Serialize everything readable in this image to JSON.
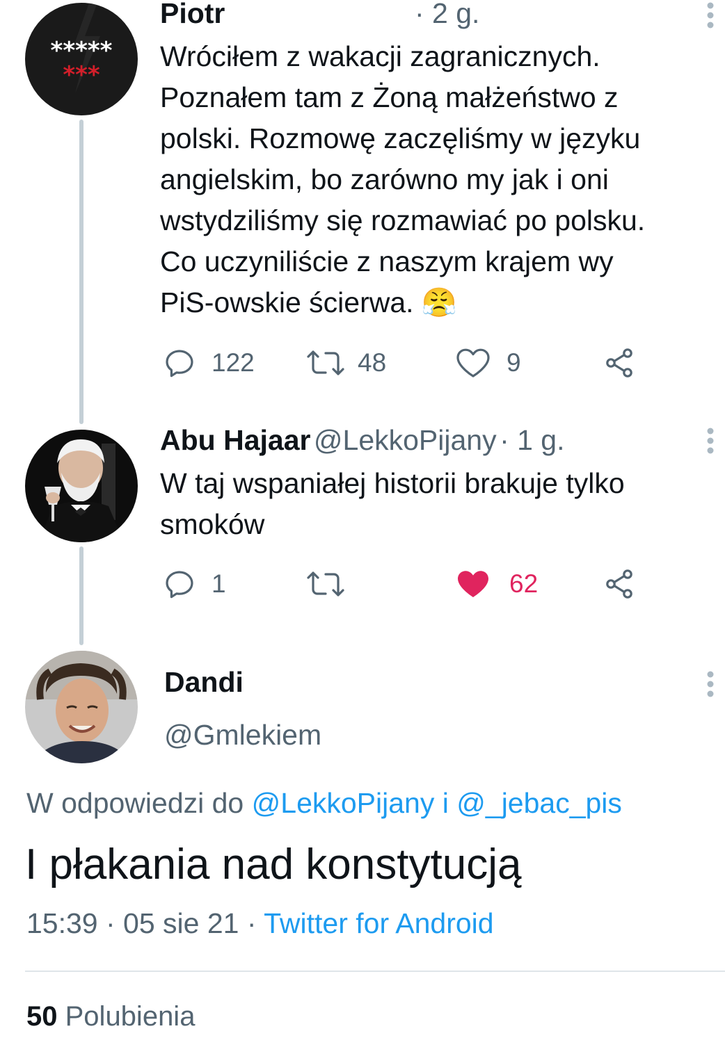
{
  "tweets": [
    {
      "name": "Piotr",
      "handle": "",
      "time": "· 2 g.",
      "text_lines": [
        "Wróciłem z wakacji zagranicznych.",
        "Poznałem tam z Żoną małżeństwo z",
        "polski. Rozmowę zaczęliśmy w języku",
        "angielskim, bo zarówno my jak i oni",
        "wstydziliśmy się rozmawiać po polsku.",
        "Co uczyniliście z naszym krajem wy",
        "PiS-owskie ścierwa. 😤"
      ],
      "avatar": {
        "text_top": "*****",
        "text_bottom": "***"
      },
      "replies": "122",
      "retweets": "48",
      "likes": "9",
      "liked": false
    },
    {
      "name": "Abu Hajaar",
      "handle": "@LekkoPijany",
      "time": "· 1 g.",
      "text_lines": [
        "W taj wspaniałej historii brakuje tylko",
        "smoków"
      ],
      "replies": "1",
      "retweets": "",
      "likes": "62",
      "liked": true
    }
  ],
  "main_tweet": {
    "name": "Dandi",
    "handle": "@Gmlekiem",
    "reply_prefix": "W odpowiedzi do",
    "reply_mention_1": "@LekkoPijany",
    "reply_joiner": "i",
    "reply_mention_2": "@_jebac_pis",
    "text": "I płakania nad konstytucją",
    "timestamp": "15:39 · 05 sie 21 ·",
    "source": "Twitter for Android",
    "likes_count": "50",
    "likes_label": "Polubienia"
  },
  "colors": {
    "text": "#0f1419",
    "secondary": "#536471",
    "link": "#1d9bf0",
    "like": "#e0245e",
    "thread_line": "#c4cfd6"
  },
  "icons": [
    "reply-icon",
    "retweet-icon",
    "like-icon",
    "share-icon",
    "more-icon"
  ]
}
